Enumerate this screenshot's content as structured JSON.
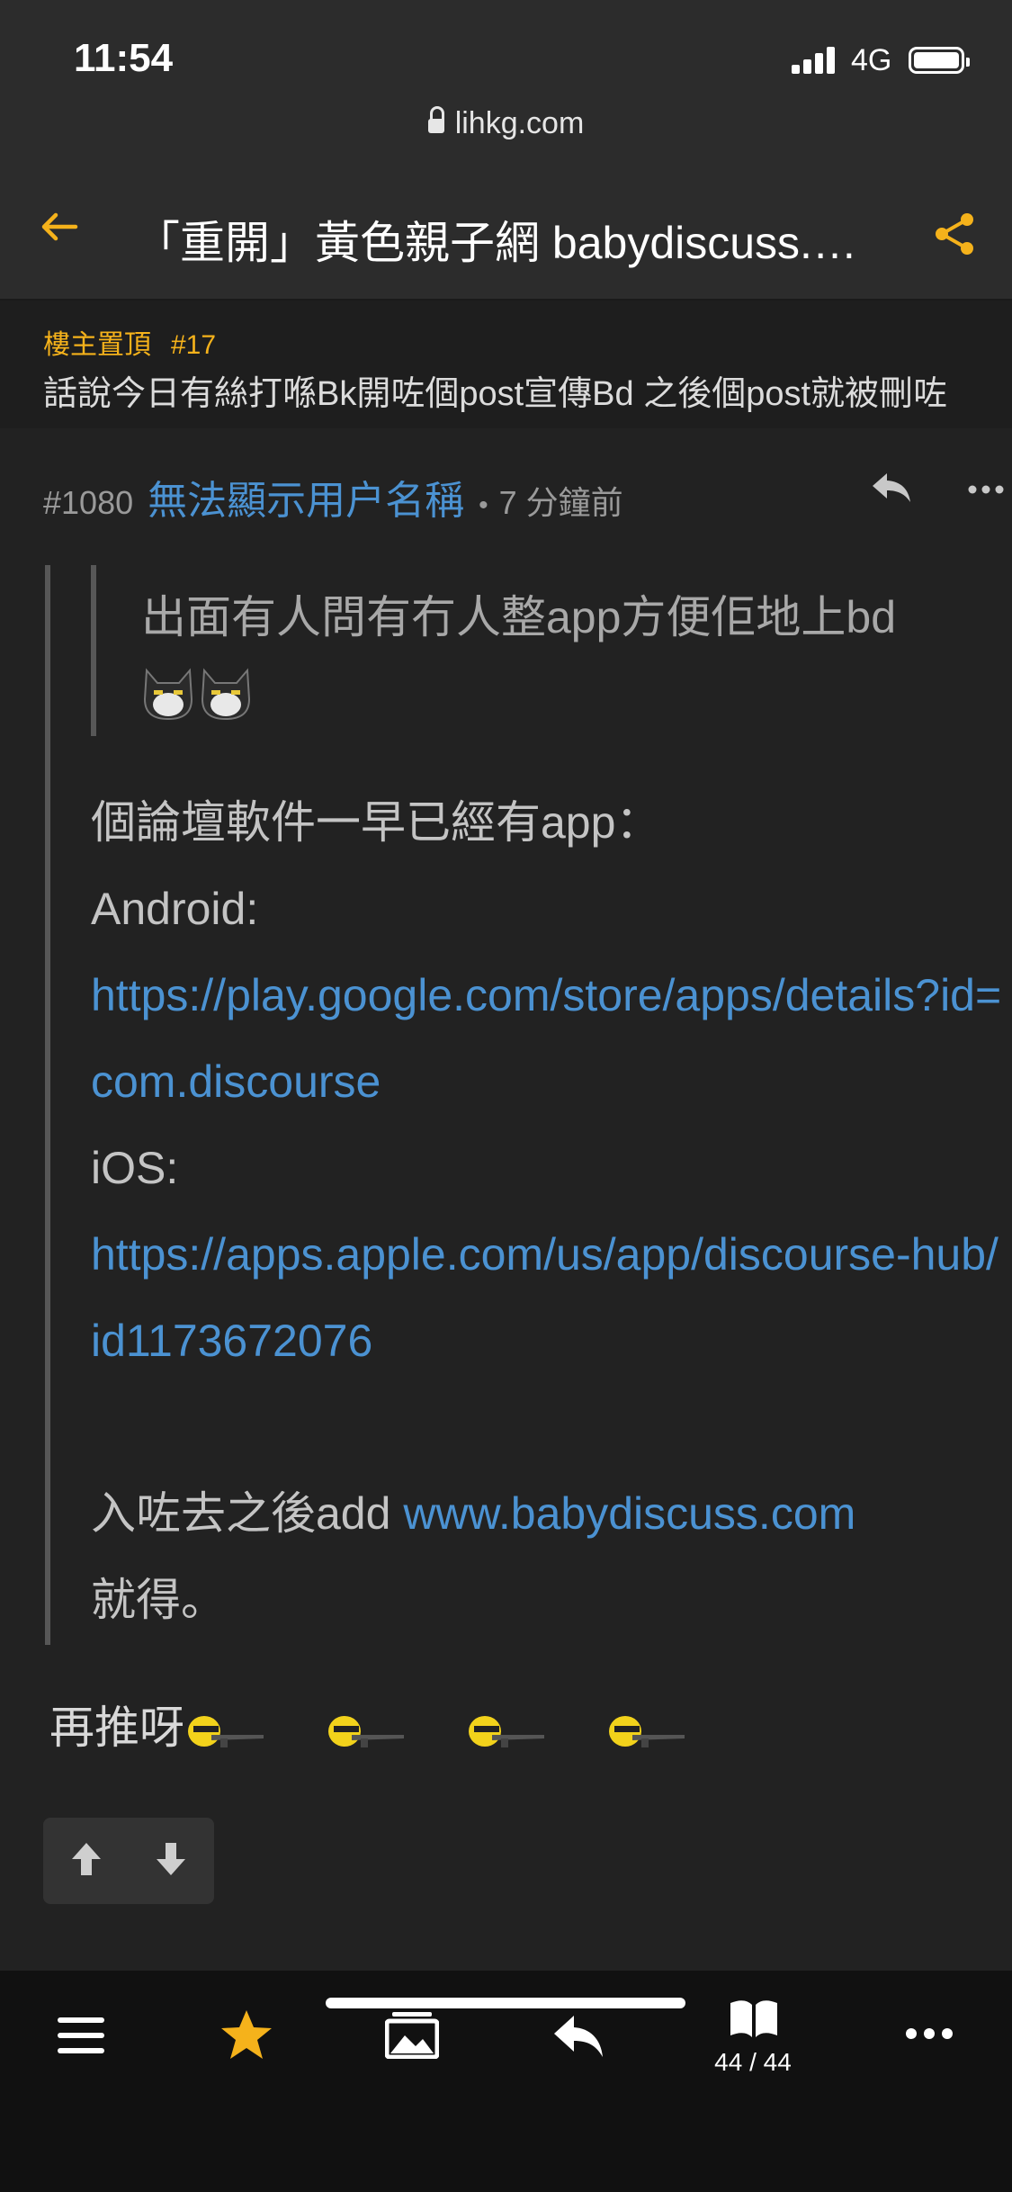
{
  "status_bar": {
    "time": "11:54",
    "network": "4G",
    "url": "lihkg.com"
  },
  "topbar": {
    "title": "「重開」黃色親子網 babydiscuss.com",
    "accent_color": "#f5b21b"
  },
  "pinned": {
    "label": "樓主置頂",
    "floor": "#17",
    "text": "話說今日有絲打喺Bk開咗個post宣傳Bd 之後個post就被刪咗"
  },
  "post": {
    "floor": "#1080",
    "username": "無法顯示用户名稱",
    "separator": "•",
    "time_ago": "7 分鐘前",
    "quote_inner": "出面有人問有冇人整app方便佢地上bd",
    "line1": "個論壇軟件一早已經有app：",
    "android_label": "Android:",
    "android_link": "https://play.google.com/store/apps/details?id=com.discourse",
    "ios_label": "iOS:",
    "ios_link": "https://apps.apple.com/us/app/discourse-hub/id1173672076",
    "add_prefix": "入咗去之後add ",
    "add_link": "www.babydiscuss.com",
    "add_suffix": "就得。",
    "reply": "再推呀"
  },
  "bottom_nav": {
    "page": "44 / 44",
    "icons": [
      "menu-icon",
      "star-icon",
      "gallery-icon",
      "reply-icon",
      "book-icon",
      "more-icon"
    ]
  }
}
